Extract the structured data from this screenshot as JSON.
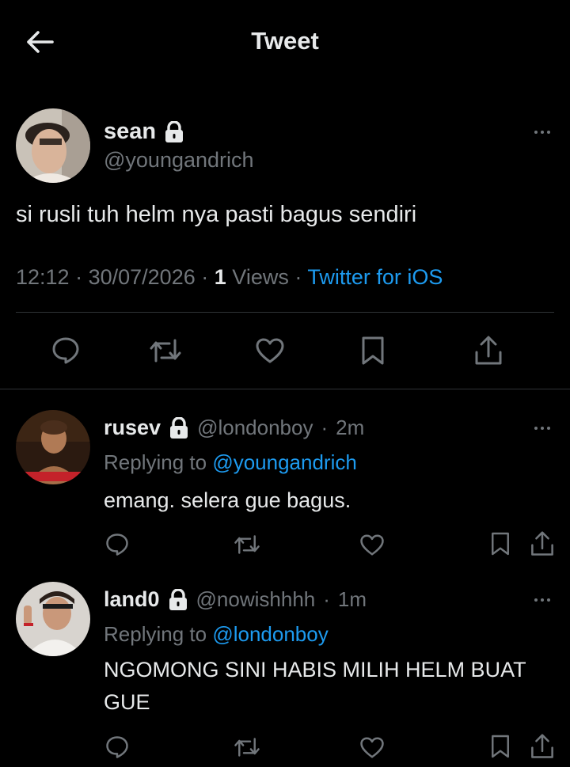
{
  "header": {
    "title": "Tweet"
  },
  "main_tweet": {
    "name": "sean",
    "handle": "@youngandrich",
    "text": "si rusli tuh helm nya pasti bagus sendiri",
    "time": "12:12",
    "date": "30/07/2026",
    "views_count": "1",
    "views_label": "Views",
    "source": "Twitter for iOS"
  },
  "replies": [
    {
      "name": "rusev",
      "handle": "@londonboy",
      "time": "2m",
      "replying_label": "Replying to",
      "replying_to": "@youngandrich",
      "text": "emang. selera gue bagus."
    },
    {
      "name": "land0",
      "handle": "@nowishhhh",
      "time": "1m",
      "replying_label": "Replying to",
      "replying_to": "@londonboy",
      "text": "NGOMONG SINI HABIS MILIH HELM BUAT GUE"
    }
  ],
  "colors": {
    "background": "#000000",
    "text": "#e7e9ea",
    "muted": "#71767b",
    "link": "#1d9bf0",
    "divider": "#2f3336"
  }
}
